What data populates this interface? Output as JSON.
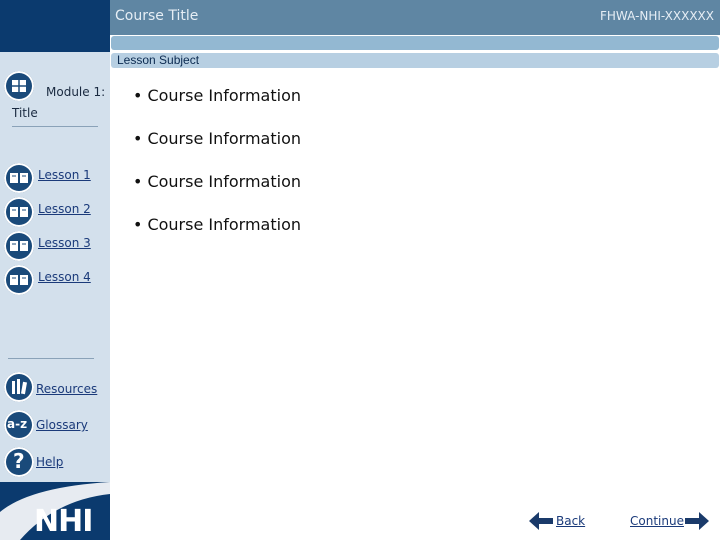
{
  "header": {
    "course_title": "Course Title",
    "course_code": "FHWA-NHI-XXXXXX"
  },
  "lesson_subject": "Lesson Subject",
  "sidebar": {
    "module_label": "Module 1:",
    "module_title": "Title",
    "lessons": [
      "Lesson 1",
      "Lesson 2",
      "Lesson 3",
      "Lesson 4"
    ],
    "resources": "Resources",
    "glossary": "Glossary",
    "glossary_icon_text": "a-z",
    "help": "Help",
    "help_icon_text": "?"
  },
  "content": {
    "bullets": [
      "Course Information",
      "Course Information",
      "Course Information",
      "Course Information"
    ]
  },
  "footer": {
    "back": "Back",
    "continue": "Continue"
  },
  "logo_text": "NHI",
  "colors": {
    "dark_blue": "#0b3a6e",
    "title_bar": "#5f86a3",
    "sidebar": "#d3e0ec"
  }
}
